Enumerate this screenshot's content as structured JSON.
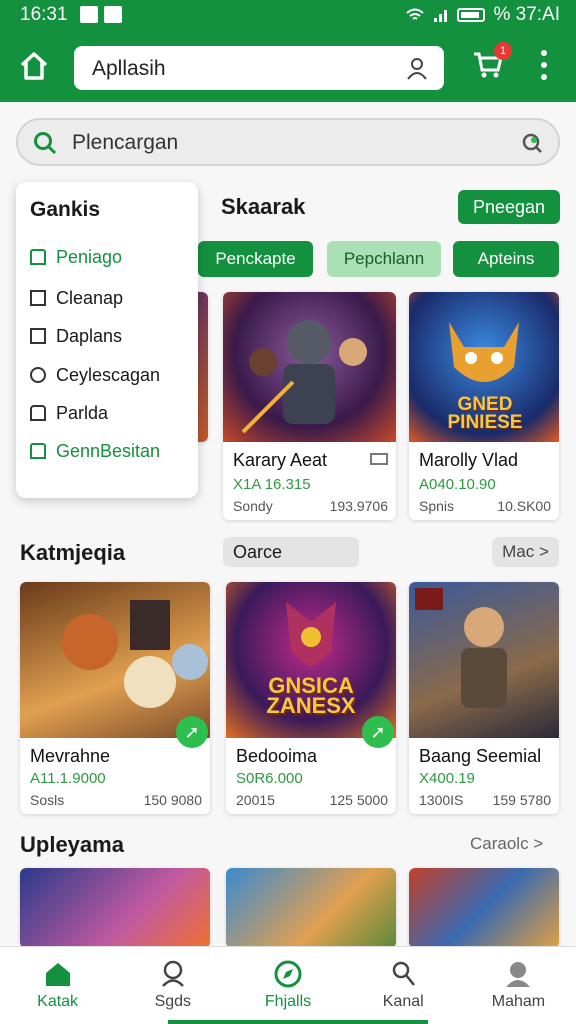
{
  "status_bar": {
    "time": "16:31",
    "right_text": "% 37:AI"
  },
  "app_bar": {
    "search_text": "Apllasih",
    "cart_badge": "1"
  },
  "search": {
    "text": "Plencargan"
  },
  "filter_panel": {
    "title": "Gankis",
    "options": [
      {
        "label": "Peniago",
        "checked": true
      },
      {
        "label": "Cleanap",
        "checked": false
      },
      {
        "label": "Daplans",
        "checked": false
      },
      {
        "label": "Ceylescagan",
        "checked": false
      },
      {
        "label": "Parlda",
        "checked": false
      },
      {
        "label": "GennBesitan",
        "checked": true
      }
    ]
  },
  "section1": {
    "title": "Skaarak",
    "action_label": "Pneegan",
    "chips": [
      "Penckapte",
      "Pepchlann",
      "Apteins"
    ]
  },
  "products_top": [
    {
      "name": "Karary Aeat",
      "price": "X1A 16.315",
      "left_meta": "Sondy",
      "right_meta": "193.9706",
      "art_text": ""
    },
    {
      "name": "Marolly Vlad",
      "price": "A040.10.90",
      "left_meta": "Spnis",
      "right_meta": "10.SK00",
      "art_text": "GNED PINIESE"
    }
  ],
  "section2": {
    "title": "Katmjeqia",
    "mid_label": "Oarce",
    "more_label": "Mac >"
  },
  "products_mid": [
    {
      "name": "Mevrahne",
      "price": "A11.1.9000",
      "left_meta": "Sosls",
      "right_meta": "150 9080",
      "art_text": ""
    },
    {
      "name": "Bedooima",
      "price": "S0R6.000",
      "left_meta": "20015",
      "right_meta": "125 5000",
      "art_text": "GNSICA ZANESX"
    },
    {
      "name": "Baang Seemial",
      "price": "X400.19",
      "left_meta": "1300IS",
      "right_meta": "159 5780",
      "art_text": ""
    }
  ],
  "section3": {
    "title": "Upleyama",
    "action_label": "Caraolc >"
  },
  "bottom_nav": [
    {
      "label": "Katak",
      "active": true
    },
    {
      "label": "Sgds",
      "active": false
    },
    {
      "label": "Fhjalls",
      "active": false
    },
    {
      "label": "Kanal",
      "active": false
    },
    {
      "label": "Maham",
      "active": false
    }
  ],
  "colors": {
    "primary": "#13913f",
    "light_green": "#a9e0b4",
    "price_green": "#2e9a3f"
  }
}
